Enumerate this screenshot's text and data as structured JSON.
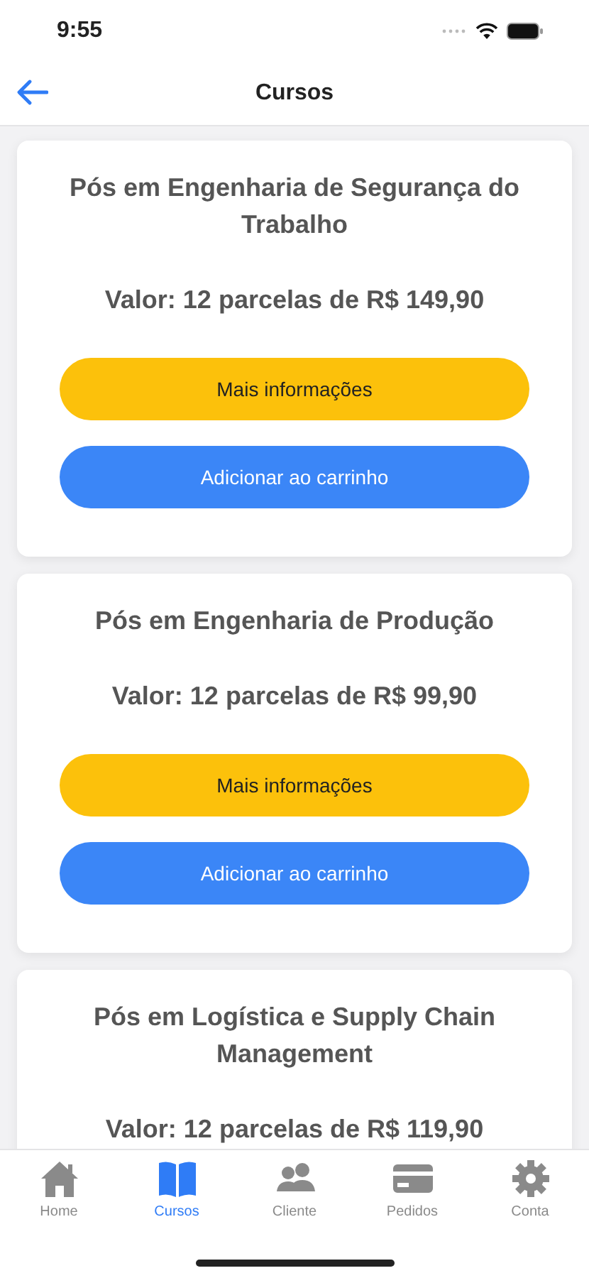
{
  "status_bar": {
    "time": "9:55"
  },
  "nav_bar": {
    "title": "Cursos"
  },
  "courses": [
    {
      "title": "Pós em Engenharia de Segurança do Trabalho",
      "price": "Valor: 12 parcelas de R$ 149,90",
      "info_button": "Mais informações",
      "cart_button": "Adicionar ao carrinho"
    },
    {
      "title": "Pós em Engenharia de Produção",
      "price": "Valor: 12 parcelas de R$ 99,90",
      "info_button": "Mais informações",
      "cart_button": "Adicionar ao carrinho"
    },
    {
      "title": "Pós em Logística e Supply Chain Management",
      "price": "Valor: 12 parcelas de R$ 119,90"
    }
  ],
  "tab_bar": [
    {
      "label": "Home",
      "selected": false
    },
    {
      "label": "Cursos",
      "selected": true
    },
    {
      "label": "Cliente",
      "selected": false
    },
    {
      "label": "Pedidos",
      "selected": false
    },
    {
      "label": "Conta",
      "selected": false
    }
  ]
}
